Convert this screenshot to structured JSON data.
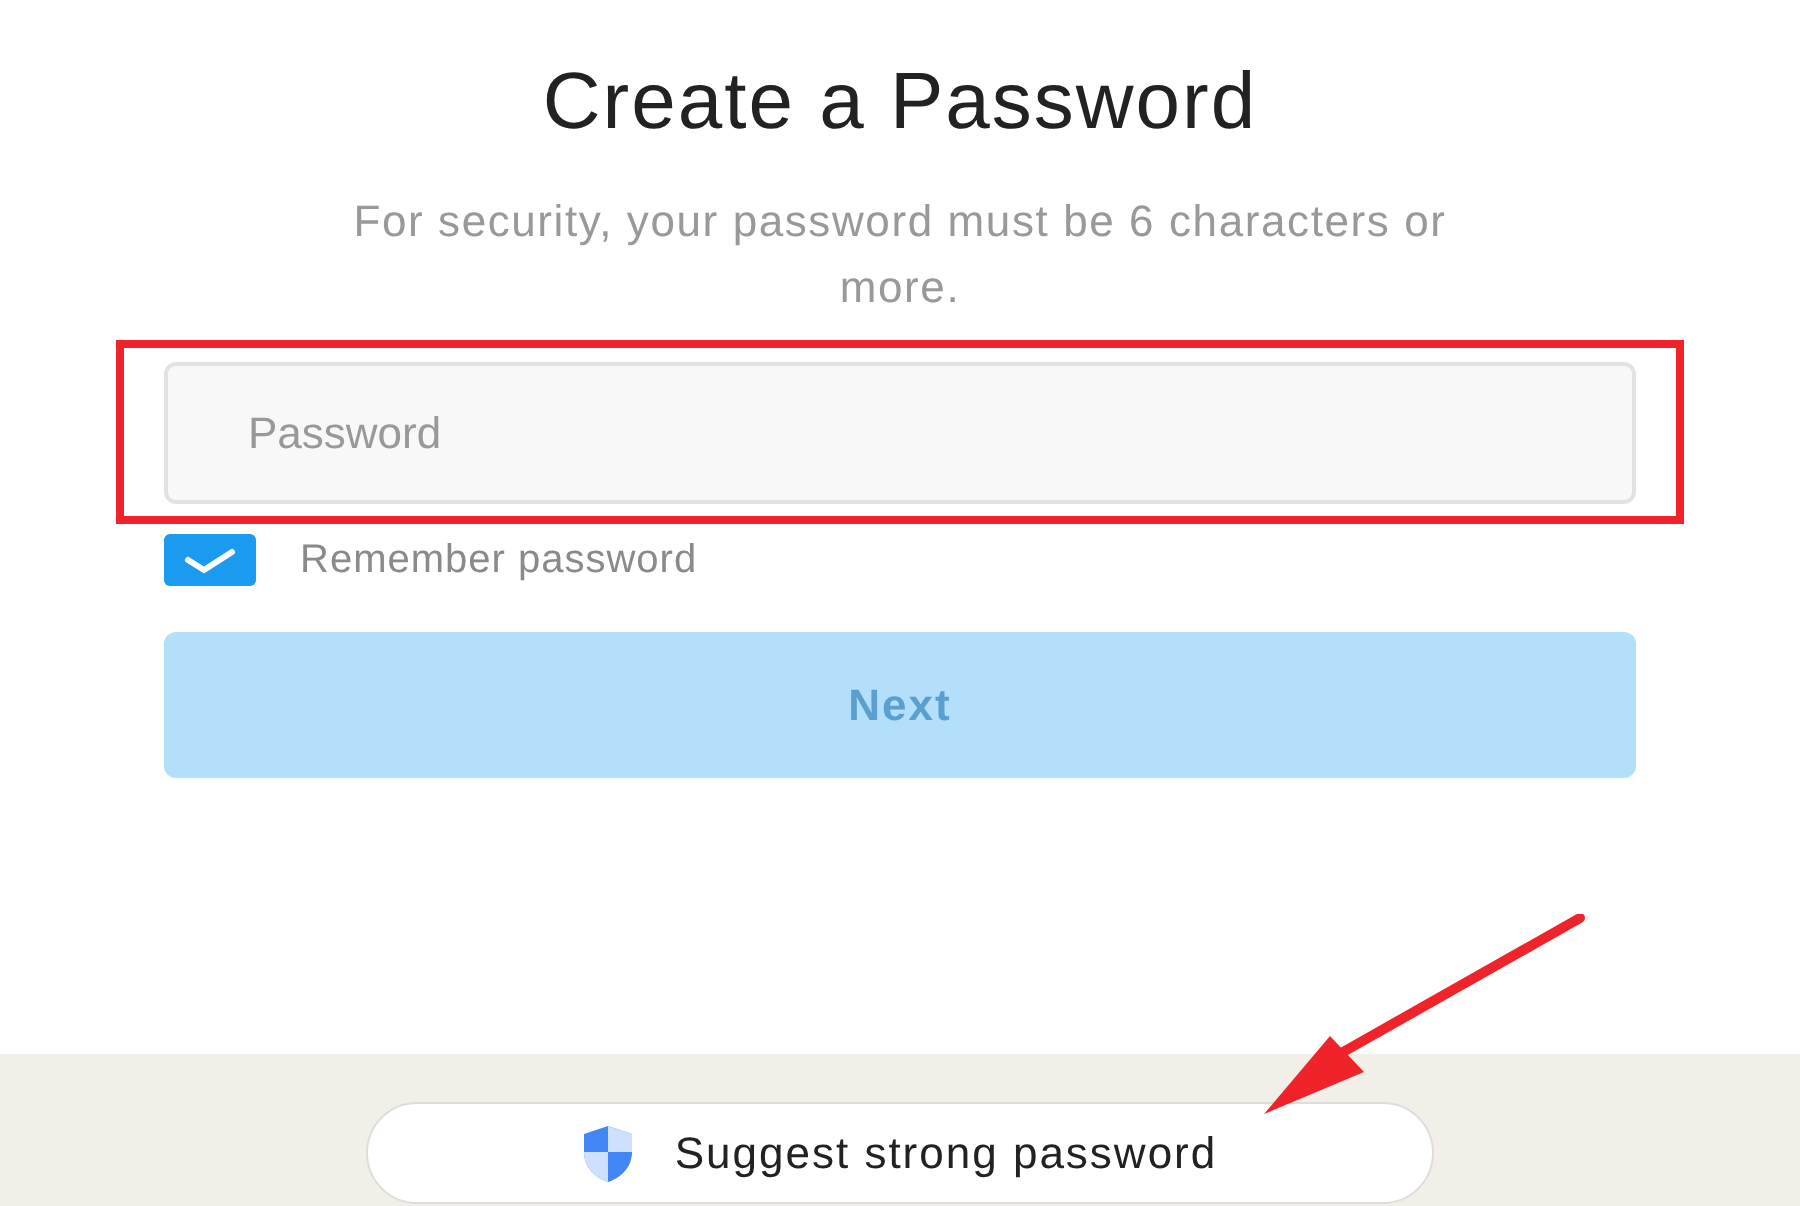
{
  "title": "Create a Password",
  "subtitle": "For security, your password must be 6 characters or more.",
  "password_field": {
    "placeholder": "Password",
    "highlighted": true
  },
  "remember_password": {
    "label": "Remember password",
    "checked": true
  },
  "next_button": {
    "label": "Next",
    "disabled": true
  },
  "suggestion_bar": {
    "label": "Suggest strong password",
    "pointed_at": true
  }
}
